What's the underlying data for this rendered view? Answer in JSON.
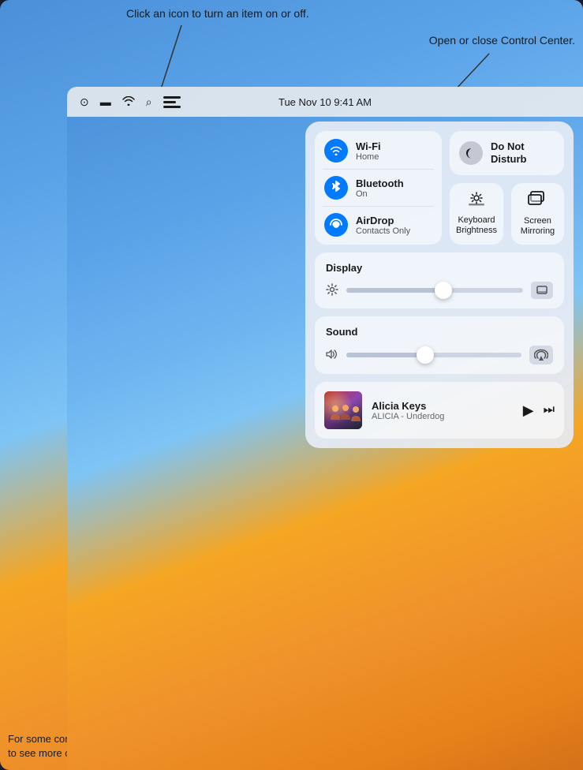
{
  "annotations": {
    "top_center": "Click an icon to turn an item on or off.",
    "top_right": "Open or close Control Center.",
    "middle_left": "Display",
    "bottom_left": "For some controls, click\nanywhere to see more options."
  },
  "menubar": {
    "datetime": "Tue Nov 10  9:41 AM"
  },
  "control_center": {
    "wifi": {
      "title": "Wi-Fi",
      "subtitle": "Home"
    },
    "bluetooth": {
      "title": "Bluetooth",
      "subtitle": "On"
    },
    "airdrop": {
      "title": "AirDrop",
      "subtitle": "Contacts Only"
    },
    "do_not_disturb": {
      "title": "Do Not\nDisturb"
    },
    "keyboard_brightness": {
      "label": "Keyboard\nBrightness"
    },
    "screen_mirroring": {
      "label": "Screen\nMirroring"
    },
    "display": {
      "title": "Display",
      "slider_value": 55
    },
    "sound": {
      "title": "Sound",
      "slider_value": 45
    },
    "now_playing": {
      "artist": "Alicia Keys",
      "track": "ALICIA - Underdog"
    }
  }
}
